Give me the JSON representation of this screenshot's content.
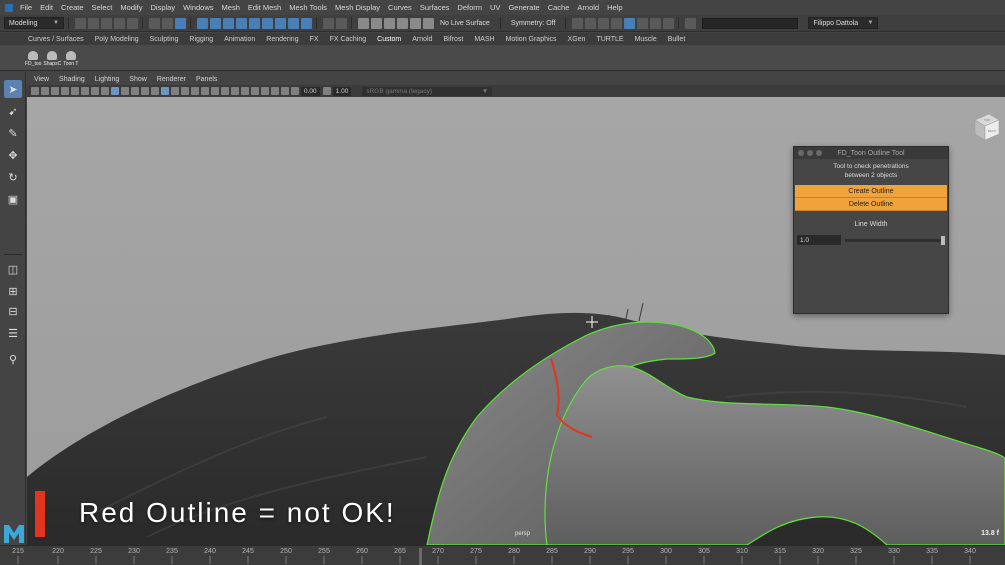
{
  "menubar": {
    "items": [
      "File",
      "Edit",
      "Create",
      "Select",
      "Modify",
      "Display",
      "Windows",
      "Mesh",
      "Edit Mesh",
      "Mesh Tools",
      "Mesh Display",
      "Curves",
      "Surfaces",
      "Deform",
      "UV",
      "Generate",
      "Cache",
      "Arnold",
      "Help"
    ]
  },
  "statusline": {
    "mode": "Modeling",
    "live_surface": "No Live Surface",
    "symmetry": "Symmetry: Off",
    "user": "Filippo Dattola"
  },
  "shelf": {
    "tabs": [
      "Curves / Surfaces",
      "Poly Modeling",
      "Sculpting",
      "Rigging",
      "Animation",
      "Rendering",
      "FX",
      "FX Caching",
      "Custom",
      "Arnold",
      "Bifrost",
      "MASH",
      "Motion Graphics",
      "XGen",
      "TURTLE",
      "Muscle",
      "Bullet"
    ],
    "active_tab": "Custom",
    "items": [
      "FD_too",
      "ShapsC",
      "Toon T"
    ]
  },
  "panel": {
    "menus": [
      "View",
      "Shading",
      "Lighting",
      "Show",
      "Renderer",
      "Panels"
    ],
    "exposure": "0.00",
    "gamma": "1.00",
    "color_space": "sRGB gamma (legacy)"
  },
  "viewport": {
    "camera": "persp",
    "fps": "13.8 f",
    "viewcube_top": "TOP",
    "viewcube_back": "BACK"
  },
  "tool_window": {
    "title": "FD_Toon Outline Tool",
    "description_line1": "Tool to check penetrations",
    "description_line2": "between 2 objects",
    "create_button": "Create Outline",
    "delete_button": "Delete Outline",
    "line_width_label": "Line Width",
    "line_width_value": "1.0",
    "line_width_slider_fraction": 1.0
  },
  "caption": {
    "text": "Red Outline = not OK!",
    "accent_color": "#e2351f"
  },
  "timeline": {
    "ticks": [
      "215",
      "220",
      "225",
      "230",
      "235",
      "240",
      "245",
      "250",
      "255",
      "260",
      "265",
      "270",
      "275",
      "280",
      "285",
      "290",
      "295",
      "300",
      "305",
      "310",
      "315",
      "320",
      "325",
      "330",
      "335",
      "340"
    ]
  },
  "colors": {
    "button_orange": "#f0a33a",
    "selection_blue": "#5b82b0",
    "outline_green": "#5fe23a",
    "outline_red": "#e2351f"
  }
}
